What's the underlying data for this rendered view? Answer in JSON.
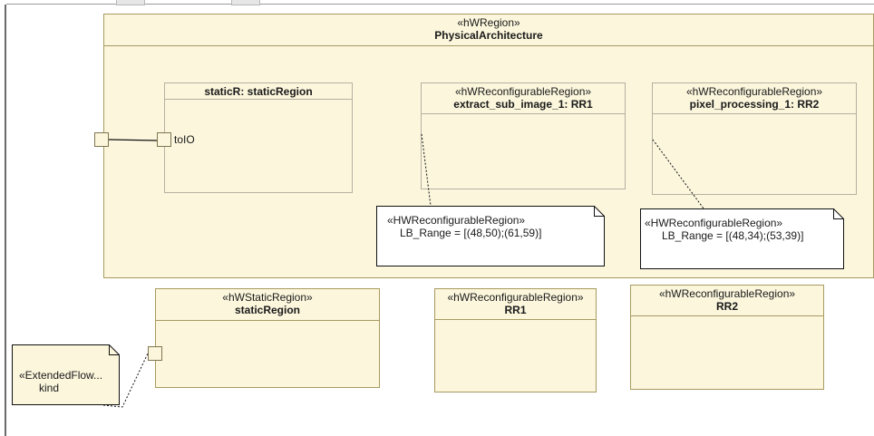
{
  "diagram": {
    "physical_architecture": {
      "stereotype": "«hWRegion»",
      "name": "PhysicalArchitecture"
    },
    "static_part": {
      "name": "staticR: staticRegion",
      "port_label": "toIO"
    },
    "rr1_part": {
      "stereotype": "«hWReconfigurableRegion»",
      "name": "extract_sub_image_1: RR1"
    },
    "rr2_part": {
      "stereotype": "«hWReconfigurableRegion»",
      "name": "pixel_processing_1: RR2"
    },
    "rr1_note": {
      "stereotype": "«HWReconfigurableRegion»",
      "value": "LB_Range = [(48,50);(61,59)]"
    },
    "rr2_note": {
      "stereotype": "«HWReconfigurableRegion»",
      "value": "LB_Range = [(48,34);(53,39)]"
    },
    "static_block": {
      "stereotype": "«hWStaticRegion»",
      "name": "staticRegion"
    },
    "rr1_block": {
      "stereotype": "«hWReconfigurableRegion»",
      "name": "RR1"
    },
    "rr2_block": {
      "stereotype": "«hWReconfigurableRegion»",
      "name": "RR2"
    },
    "flow_note": {
      "stereotype": "«ExtendedFlow...",
      "value": "kind"
    }
  },
  "colors": {
    "fill": "#fbf6dc",
    "border": "#a89a60",
    "inner_border": "#b6b0a2"
  }
}
